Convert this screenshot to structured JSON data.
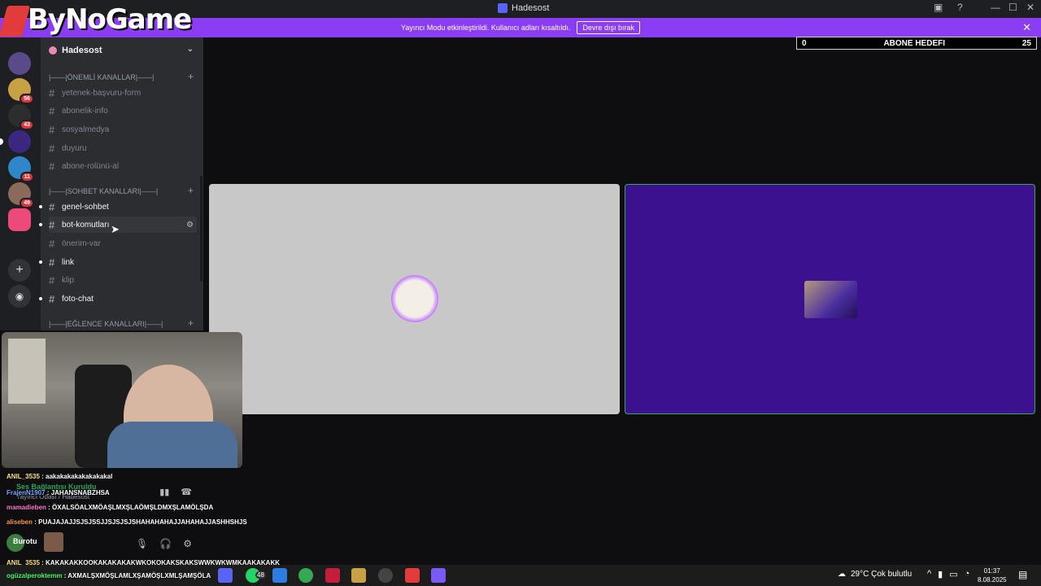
{
  "window": {
    "title": "Hadesost"
  },
  "overlay": {
    "logo_text": "ByNoGame"
  },
  "banner": {
    "text": "Yayıncı Modu etkinleştirildi. Kullanıcı adları kısaltıldı.",
    "button": "Devre dışı bırak"
  },
  "goal": {
    "left": "0",
    "label": "ABONE HEDEFI",
    "right": "25"
  },
  "servers": [
    {
      "badge": "",
      "color": "#6b5a4a"
    },
    {
      "badge": "56",
      "color": "#c8a046"
    },
    {
      "badge": "43",
      "color": "#2d2d2d"
    },
    {
      "badge": "",
      "color": "#3a2780"
    },
    {
      "badge": "11",
      "color": "#2f86c9"
    },
    {
      "badge": "49",
      "color": "#8a6a5a"
    },
    {
      "badge": "",
      "color": "#ec4a7a"
    }
  ],
  "guild": {
    "name": "Hadesost"
  },
  "categories": [
    "|——|ÖNEMLİ KANALLAR|——|",
    "|——|SOHBET KANALLARI|——|",
    "|——|EĞLENCE KANALLARI|——|"
  ],
  "channels": [
    "yetenek-başvuru-form",
    "abonelik-info",
    "sosyalmedya",
    "duyuru",
    "abone-rolünü-al",
    "genel-sohbet",
    "bot-komutları",
    "önerim-var",
    "link",
    "klip",
    "foto-chat"
  ],
  "voice": {
    "status": "Ses Bağlantısı Kuruldu",
    "location": "Yayıncı Odası / Hadesost"
  },
  "user": {
    "name": "Burotu",
    "short": "Ha"
  },
  "chat": [
    {
      "user": "ANIL_3535",
      "msg": "aakakakakakakakakal"
    },
    {
      "user": "FrajenN1907",
      "msg": "JAHANSNABZHSA"
    },
    {
      "user": "mamadieben",
      "msg": "ÖXALSÖALXMÖAŞLMXŞLAÖMŞLDMXŞLAMÖLŞDA"
    },
    {
      "user": "aliseben",
      "msg": "PUAJAJAJJSJSJSSJJSJSJSJSHAHAHAHAJJAHAHAJJASHHSHJS"
    },
    {
      "user": "ANIL_3535",
      "msg": "KAKAKAKKQQKAKAKAKAKWKQKQKAKSKAKSWWKWKWMKAAKAKAKK"
    },
    {
      "user": "ogüzalperoktemm",
      "msg": "AXMALŞXMÖŞLAMLXŞAMÖŞLXMLŞAMŞÖLA"
    }
  ],
  "taskbar": {
    "weather": "29°C  Çok bulutlu",
    "time": "01:37",
    "date": "8.08.2025",
    "whatsapp_badge": "48"
  }
}
